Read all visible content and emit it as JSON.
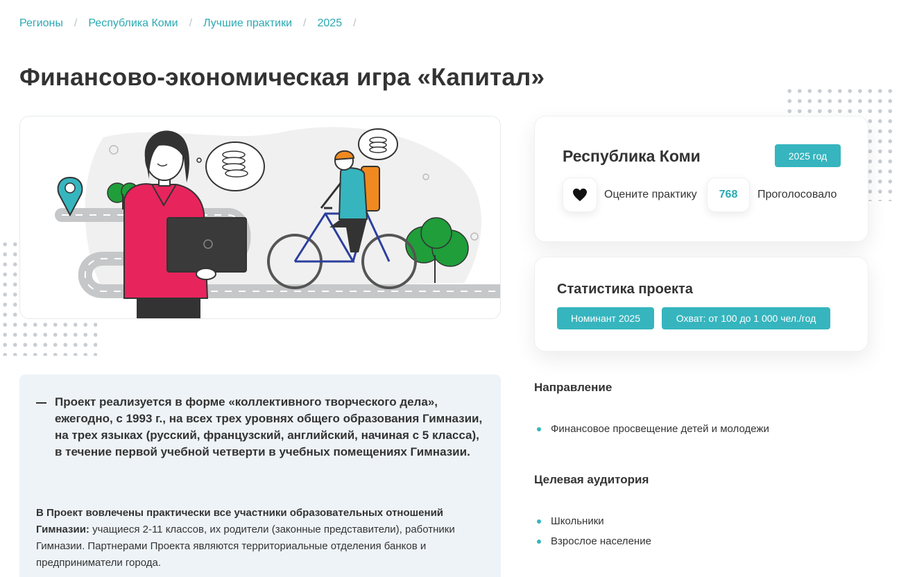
{
  "breadcrumb": [
    "Регионы",
    "Республика Коми",
    "Лучшие практики",
    "2025"
  ],
  "separator": "/",
  "title": "Финансово-экономическая игра «Капитал»",
  "region_card": {
    "region": "Республика Коми",
    "year_badge": "2025 год",
    "rate_label": "Оцените практику",
    "votes": "768",
    "voted_label": "Проголосовало",
    "like_icon": "heart-icon"
  },
  "stats": {
    "title": "Статистика проекта",
    "tags": [
      "Номинант 2025",
      "Охват: от 100 до 1 000 чел./год"
    ]
  },
  "description": {
    "lead": "Проект реализуется в форме «коллективного творческого дела», ежегодно, с 1993 г., на всех трех уровнях общего образования Гимназии, на трех языках (русский, французский, английский, начиная с 5 класса), в течение первой учебной четверти в учебных помещениях Гимназии.",
    "body_bold": "В Проект вовлечены практически все участники образовательных отношений Гимназии:",
    "body_rest": " учащиеся 2-11 классов, их родители (законные представители), работники Гимназии. Партнерами Проекта являются территориальные отделения банков и предприниматели города."
  },
  "direction": {
    "title": "Направление",
    "items": [
      "Финансовое просвещение детей и молодежи"
    ]
  },
  "audience": {
    "title": "Целевая аудитория",
    "items": [
      "Школьники",
      "Взрослое население"
    ]
  },
  "colors": {
    "accent": "#36b5be",
    "link": "#2aa9b3",
    "panel": "#eef3f7",
    "shirt": "#e8245c",
    "tree": "#1f9e3a"
  }
}
